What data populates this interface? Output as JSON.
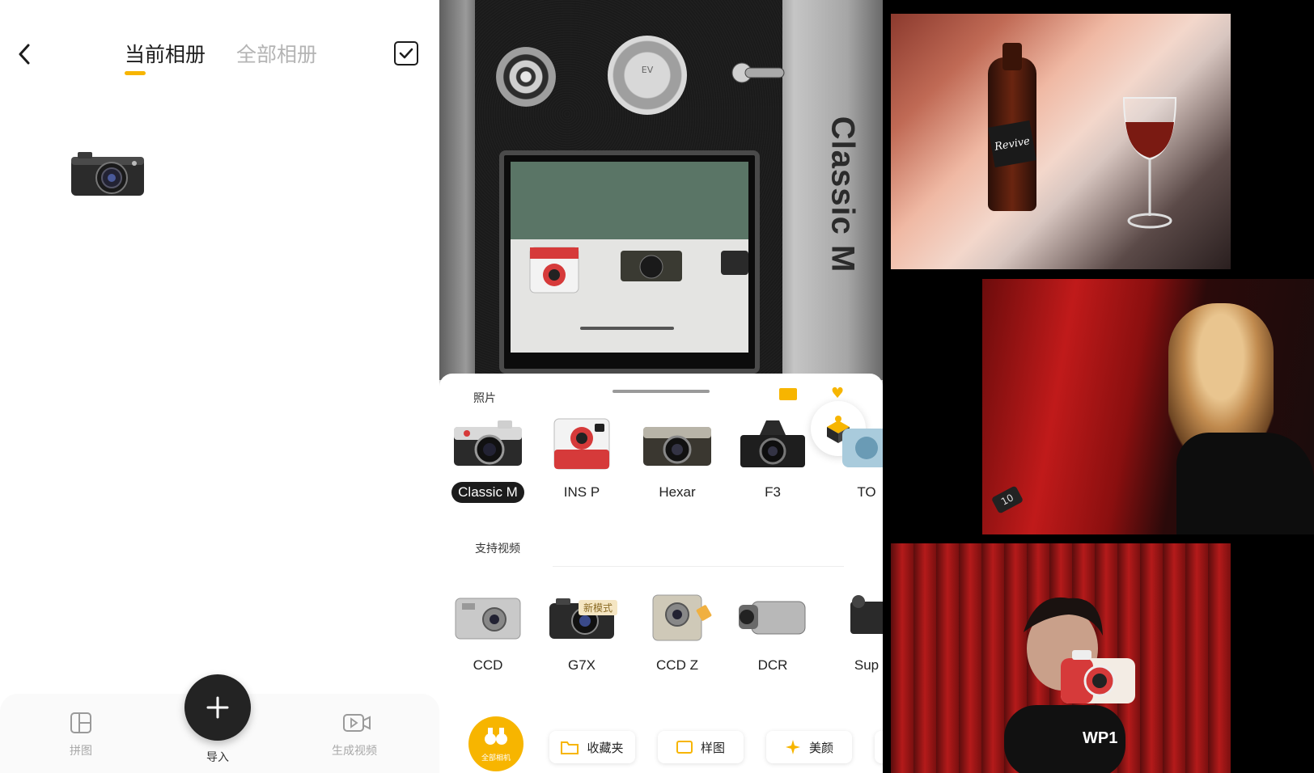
{
  "album_screen": {
    "tabs": [
      {
        "label": "当前相册",
        "active": true
      },
      {
        "label": "全部相册",
        "active": false
      }
    ],
    "bottom_bar": {
      "collage_label": "拼图",
      "import_label": "导入",
      "video_label": "生成视频"
    }
  },
  "camera_screen": {
    "engraving": "Classic M",
    "dial_label": "EV",
    "sections": {
      "photo_label": "照片",
      "video_label": "支持视频"
    },
    "photo_cameras": [
      {
        "name": "Classic M",
        "selected": true
      },
      {
        "name": "INS P",
        "selected": false
      },
      {
        "name": "Hexar",
        "selected": false
      },
      {
        "name": "F3",
        "selected": false
      },
      {
        "name": "TO",
        "selected": false
      }
    ],
    "video_cameras": [
      {
        "name": "CCD"
      },
      {
        "name": "G7X",
        "tag": "新模式"
      },
      {
        "name": "CCD Z"
      },
      {
        "name": "DCR"
      },
      {
        "name": "Sup"
      }
    ],
    "tabbar": {
      "all_cameras": "全部相机",
      "favorites": "收藏夹",
      "samples": "样图",
      "beauty": "美颜"
    }
  },
  "sample_photos": {
    "bottle_label": "Revive",
    "seat_number": "10",
    "camera_badge": "WP1"
  },
  "colors": {
    "accent": "#f7b500",
    "dark": "#1c1c1c",
    "muted": "#b4b4b4"
  }
}
